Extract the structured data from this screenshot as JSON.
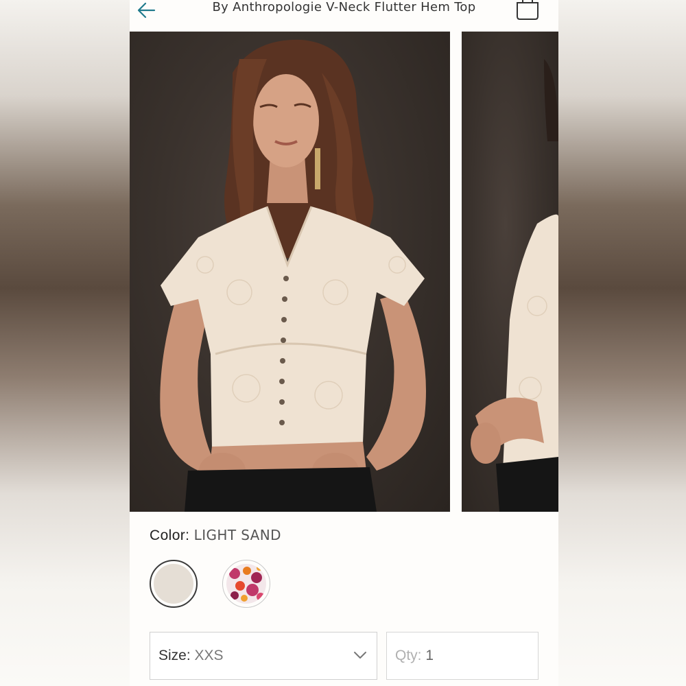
{
  "header": {
    "title": "By Anthropologie V-Neck Flutter Hem Top",
    "back_icon": "arrow-left-icon",
    "bag_icon": "shopping-bag-icon",
    "accent": "#1f7a8c"
  },
  "gallery": {
    "images": [
      {
        "alt": "model-front-view"
      },
      {
        "alt": "model-side-view"
      }
    ]
  },
  "color": {
    "label": "Color:",
    "selected": "LIGHT SAND",
    "swatches": [
      {
        "name": "light-sand",
        "hex": "#e5ded5",
        "selected": true
      },
      {
        "name": "floral",
        "hex": "#c0396a",
        "selected": false
      }
    ]
  },
  "size": {
    "label": "Size:",
    "value": "XXS"
  },
  "qty": {
    "label": "Qty:",
    "value": "1"
  }
}
